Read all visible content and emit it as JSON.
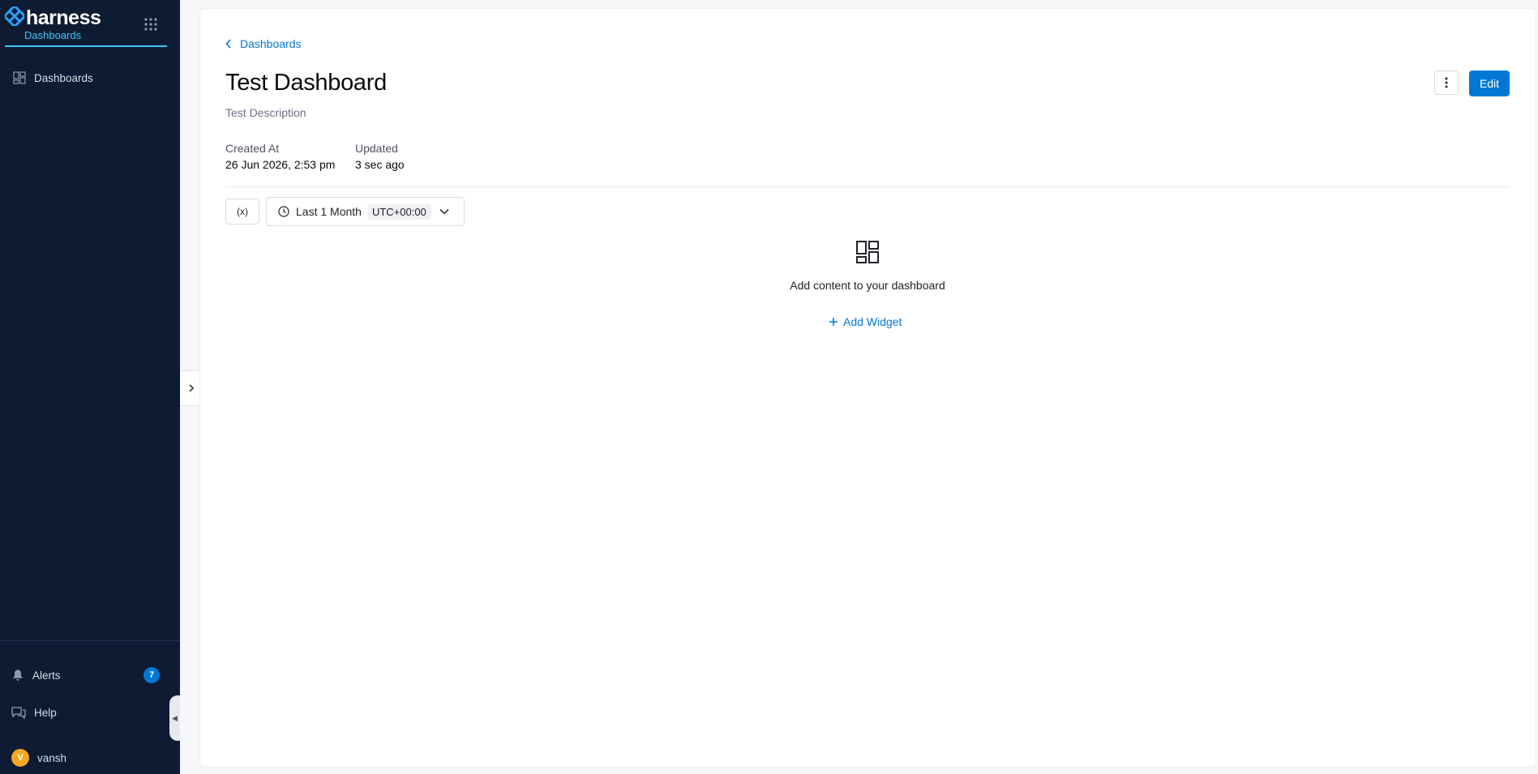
{
  "sidebar": {
    "brand_name": "harness",
    "module_name": "Dashboards",
    "nav": [
      {
        "label": "Dashboards",
        "icon": "dashboard-grid-icon"
      }
    ],
    "alerts_label": "Alerts",
    "alerts_count": "7",
    "help_label": "Help",
    "user_initial": "V",
    "user_name": "vansh"
  },
  "page": {
    "breadcrumb": "Dashboards",
    "title": "Test Dashboard",
    "description": "Test Description",
    "meta": {
      "created_label": "Created At",
      "created_value": "26 Jun 2026, 2:53 pm",
      "updated_label": "Updated",
      "updated_value": "3 sec ago"
    },
    "actions": {
      "edit_label": "Edit"
    },
    "filters": {
      "variables_label": "(x)",
      "time_range": "Last 1 Month",
      "timezone": "UTC+00:00"
    },
    "empty_state": {
      "message": "Add content to your dashboard",
      "add_widget_label": "Add Widget"
    }
  },
  "colors": {
    "sidebar_bg": "#0f1b33",
    "accent": "#0278d5",
    "brand_cyan": "#3dc7f6"
  }
}
